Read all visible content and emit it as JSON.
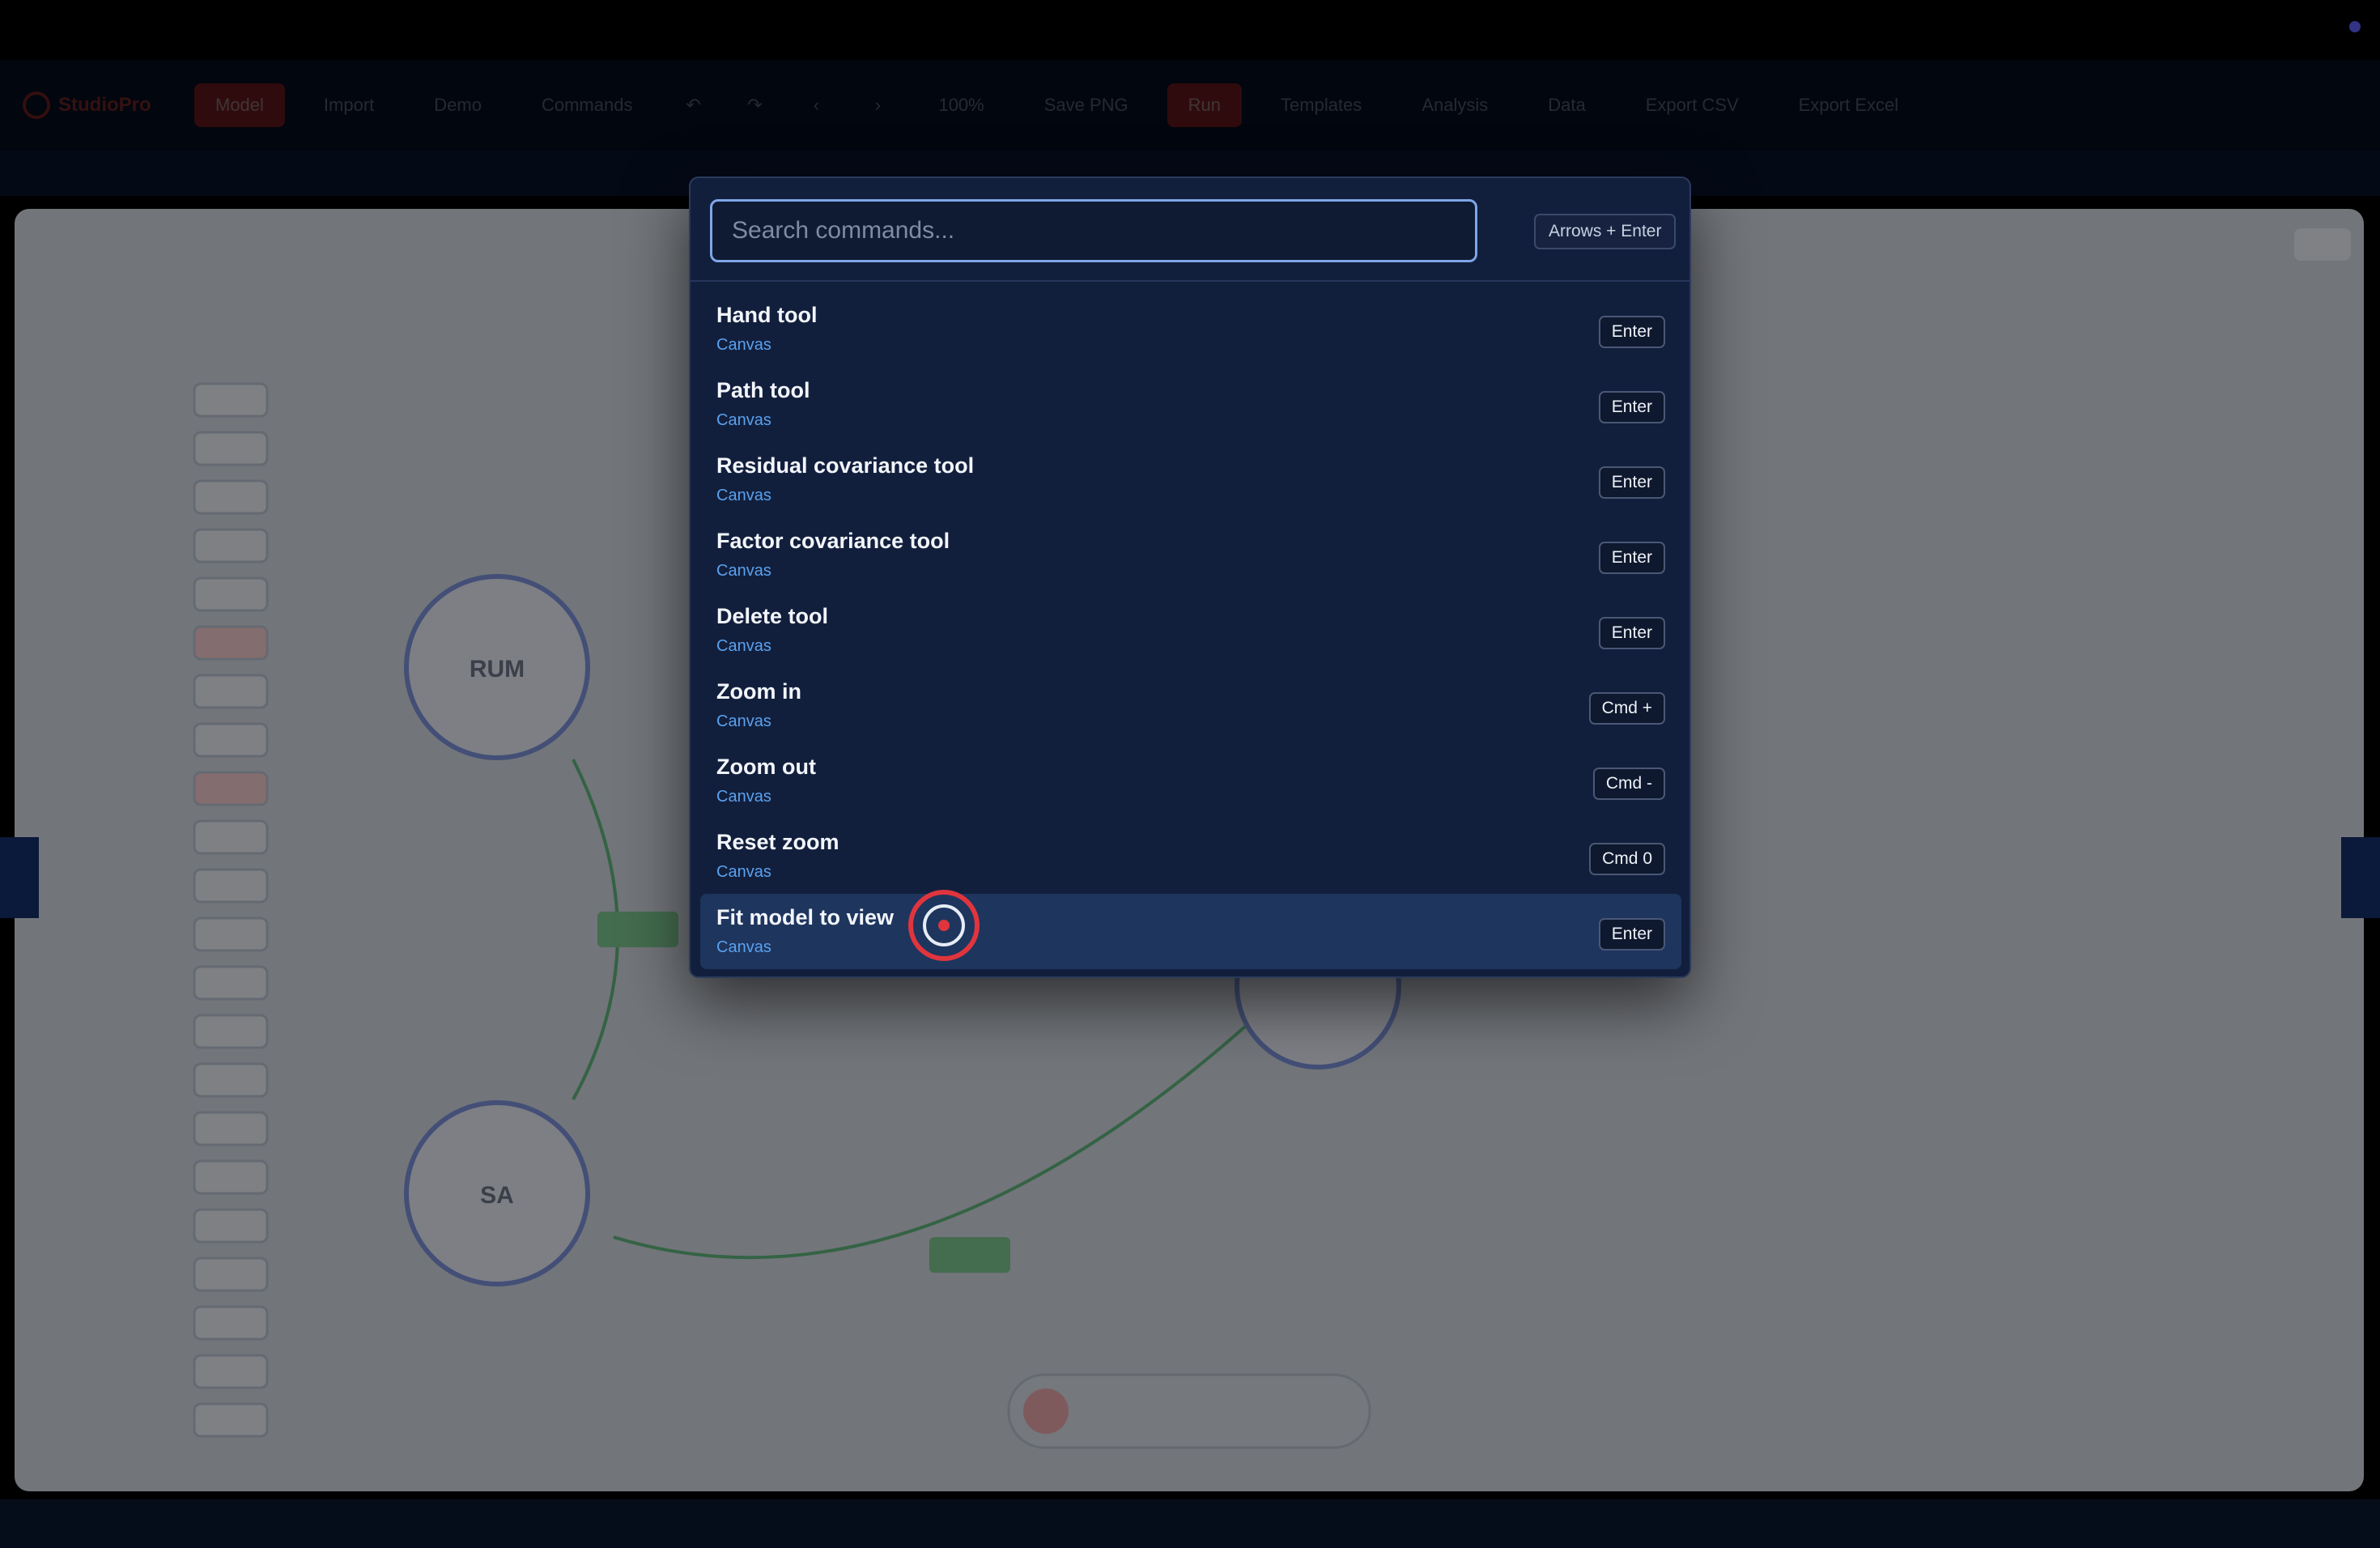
{
  "toolbar": {
    "app_name": "StudioPro",
    "items": [
      "Model",
      "Import",
      "Demo",
      "Commands",
      "",
      "",
      "‹",
      "›",
      "100%",
      "Save PNG",
      "Run",
      "Templates",
      "Analysis",
      "Data",
      "Export CSV",
      "Export Excel"
    ]
  },
  "palette": {
    "search_placeholder": "Search commands...",
    "hint": "Arrows + Enter",
    "commands": [
      {
        "title": "Hand tool",
        "category": "Canvas",
        "shortcut": "Enter"
      },
      {
        "title": "Path tool",
        "category": "Canvas",
        "shortcut": "Enter"
      },
      {
        "title": "Residual covariance tool",
        "category": "Canvas",
        "shortcut": "Enter"
      },
      {
        "title": "Factor covariance tool",
        "category": "Canvas",
        "shortcut": "Enter"
      },
      {
        "title": "Delete tool",
        "category": "Canvas",
        "shortcut": "Enter"
      },
      {
        "title": "Zoom in",
        "category": "Canvas",
        "shortcut": "Cmd +"
      },
      {
        "title": "Zoom out",
        "category": "Canvas",
        "shortcut": "Cmd -"
      },
      {
        "title": "Reset zoom",
        "category": "Canvas",
        "shortcut": "Cmd 0"
      },
      {
        "title": "Fit model to view",
        "category": "Canvas",
        "shortcut": "Enter"
      }
    ],
    "active_index": 8
  },
  "canvas": {
    "factor_labels": [
      "RUM",
      "SA"
    ]
  },
  "colors": {
    "accent": "#7ea6e8",
    "active_row": "#1e355e",
    "danger": "#e0353d",
    "category_text": "#5aa1ee"
  }
}
